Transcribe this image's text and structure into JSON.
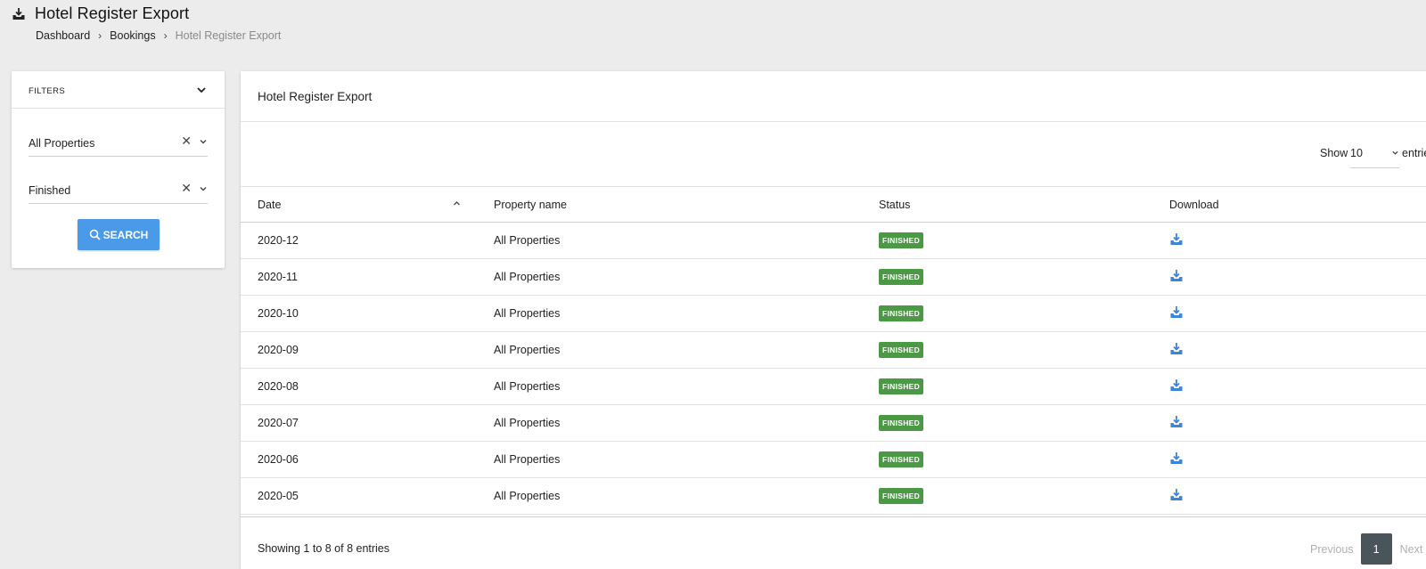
{
  "header": {
    "title": "Hotel Register Export",
    "icon": "download-tray-icon",
    "breadcrumb": [
      "Dashboard",
      "Bookings",
      "Hotel Register Export"
    ],
    "separator": "›"
  },
  "filters": {
    "title": "FILTERS",
    "property_select": {
      "value": "All Properties",
      "clear": "✕"
    },
    "status_select": {
      "value": "Finished",
      "clear": "✕"
    },
    "search_label": "SEARCH",
    "accent": "#4a9ae8"
  },
  "main": {
    "title": "Hotel Register Export",
    "length": {
      "label": "Show",
      "value": "10",
      "suffix": "entries"
    },
    "columns": [
      "Date",
      "Property name",
      "Status",
      "Download"
    ],
    "rows": [
      {
        "date": "2020-12",
        "property": "All Properties",
        "status": "FINISHED"
      },
      {
        "date": "2020-11",
        "property": "All Properties",
        "status": "FINISHED"
      },
      {
        "date": "2020-10",
        "property": "All Properties",
        "status": "FINISHED"
      },
      {
        "date": "2020-09",
        "property": "All Properties",
        "status": "FINISHED"
      },
      {
        "date": "2020-08",
        "property": "All Properties",
        "status": "FINISHED"
      },
      {
        "date": "2020-07",
        "property": "All Properties",
        "status": "FINISHED"
      },
      {
        "date": "2020-06",
        "property": "All Properties",
        "status": "FINISHED"
      },
      {
        "date": "2020-05",
        "property": "All Properties",
        "status": "FINISHED"
      }
    ],
    "info": "Showing 1 to 8 of 8 entries",
    "pagination": {
      "previous": "Previous",
      "page": "1",
      "next": "Next"
    },
    "status_color": "#4b9845"
  }
}
